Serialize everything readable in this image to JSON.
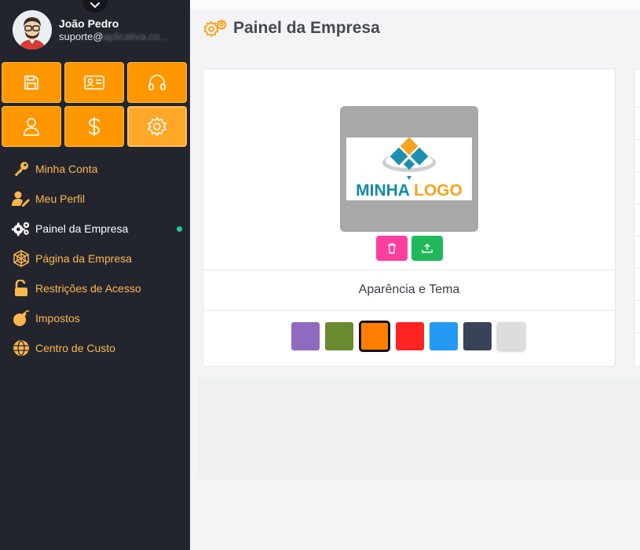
{
  "user": {
    "name": "João Pedro",
    "email_visible": "suporte@",
    "email_blurred": "aplicativa.co..."
  },
  "quick_tiles": [
    {
      "icon": "save-icon",
      "active": false
    },
    {
      "icon": "id-card-icon",
      "active": false
    },
    {
      "icon": "headphones-icon",
      "active": false
    },
    {
      "icon": "user-icon",
      "active": false
    },
    {
      "icon": "dollar-icon",
      "active": false
    },
    {
      "icon": "gear-icon",
      "active": true
    }
  ],
  "menu": {
    "items": [
      {
        "label": "Minha Conta",
        "icon": "key-icon",
        "active": false
      },
      {
        "label": "Meu Perfil",
        "icon": "user-edit-icon",
        "active": false
      },
      {
        "label": "Painel da Empresa",
        "icon": "gears-icon",
        "active": true
      },
      {
        "label": "Página da Empresa",
        "icon": "spider-web-icon",
        "active": false
      },
      {
        "label": "Restrições de Acesso",
        "icon": "unlock-icon",
        "active": false
      },
      {
        "label": "Impostos",
        "icon": "bomb-icon",
        "active": false
      },
      {
        "label": "Centro de Custo",
        "icon": "globe-icon",
        "active": false
      }
    ]
  },
  "page": {
    "title": "Painel da Empresa",
    "title_icon": "gears-icon"
  },
  "company_card": {
    "logo": {
      "word1": "MINHA",
      "word2": "LOGO"
    },
    "delete_icon": "trash-icon",
    "upload_icon": "upload-icon",
    "section_title": "Aparência e Tema",
    "theme_colors": [
      {
        "hex": "#8e6bbf",
        "selected": false
      },
      {
        "hex": "#6a8a2f",
        "selected": false
      },
      {
        "hex": "#ff8000",
        "selected": true
      },
      {
        "hex": "#ff2323",
        "selected": false
      },
      {
        "hex": "#2399f3",
        "selected": false
      },
      {
        "hex": "#38435a",
        "selected": false
      },
      {
        "hex": "#dddddd",
        "selected": false
      }
    ]
  },
  "colors": {
    "sidebar_bg": "#22252e",
    "accent": "#ff9800",
    "menu_text": "#ffb74d",
    "active_dot": "#1ec8a0",
    "delete_button": "#ff3e9e",
    "upload_button": "#1fb95a"
  }
}
